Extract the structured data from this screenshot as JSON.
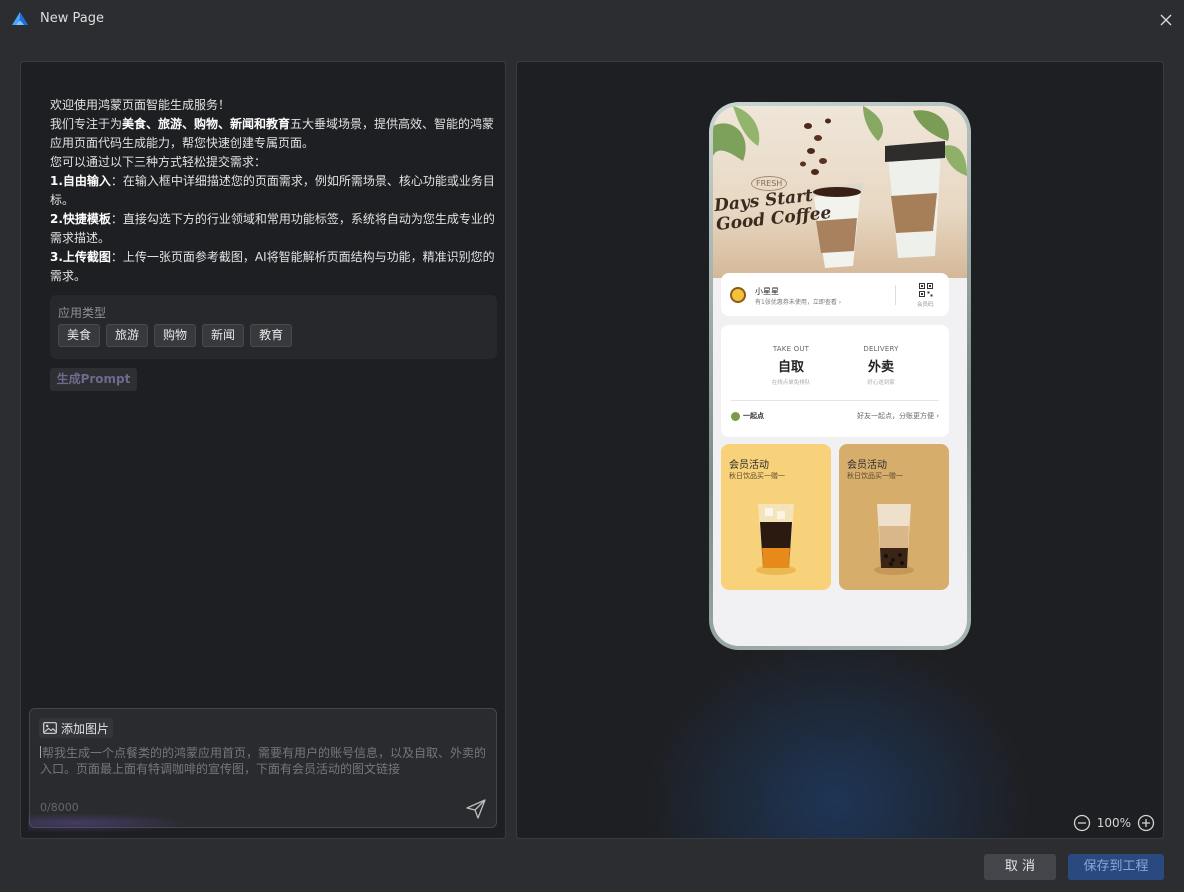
{
  "window": {
    "title": "New Page"
  },
  "intro": {
    "line1": "欢迎使用鸿蒙页面智能生成服务！",
    "line2_pre": "我们专注于为",
    "line2_bold": "美食、旅游、购物、新闻和教育",
    "line2_post": "五大垂域场景，提供高效、智能的鸿蒙应用页面代码生成能力，帮您快速创建专属页面。",
    "line3": "您可以通过以下三种方式轻松提交需求：",
    "item1_bold": "1.自由输入",
    "item1_text": "：在输入框中详细描述您的页面需求，例如所需场景、核心功能或业务目标。",
    "item2_bold": "2.快捷模板",
    "item2_text": "：直接勾选下方的行业领域和常用功能标签，系统将自动为您生成专业的需求描述。",
    "item3_bold": "3.上传截图",
    "item3_text": "：上传一张页面参考截图，AI将智能解析页面结构与功能，精准识别您的需求。"
  },
  "app_type": {
    "label": "应用类型",
    "tags": [
      "美食",
      "旅游",
      "购物",
      "新闻",
      "教育"
    ]
  },
  "generate_button": "生成Prompt",
  "input": {
    "add_image_label": "添加图片",
    "placeholder": "帮我生成一个点餐类的的鸿蒙应用首页，需要有用户的账号信息，以及自取、外卖的入口。页面最上面有特调咖啡的宣传图，下面有会员活动的图文链接",
    "char_count": "0/8000"
  },
  "preview": {
    "hero_title_line1": "Days Start",
    "hero_title_line2": "Good Coffee",
    "hero_badge": "FRESH",
    "account": {
      "name": "小星星",
      "subtitle": "有1张优惠券未使用，立即查看 ›",
      "qr_label": "会员码"
    },
    "order": {
      "pickup_en": "TAKE OUT",
      "pickup_zh": "自取",
      "pickup_hint": "在线点单免排队",
      "delivery_en": "DELIVERY",
      "delivery_zh": "外卖",
      "delivery_hint": "好心送到家",
      "together_label": "一起点",
      "together_hint": "好友一起点，分账更方便 ›"
    },
    "promos": [
      {
        "title": "会员活动",
        "subtitle": "秋日饮品买一赠一",
        "color": "#f8d27a"
      },
      {
        "title": "会员活动",
        "subtitle": "秋日饮品买一赠一",
        "color": "#d7ad6c"
      }
    ]
  },
  "zoom": {
    "level": "100%"
  },
  "footer": {
    "cancel_label": "取 消",
    "save_label": "保存到工程"
  },
  "colors": {
    "background": "#2b2d30",
    "panel": "#1e1f22",
    "primary_button": "#2a4a7f",
    "secondary_button": "#43454a"
  }
}
